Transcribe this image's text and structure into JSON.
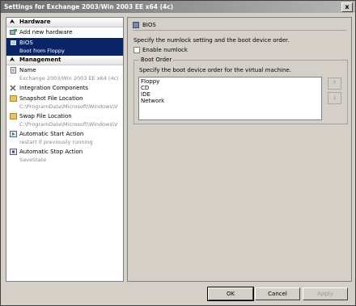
{
  "window": {
    "title": "Settings for Exchange 2003/Win 2003 EE x64 (4c)",
    "close_glyph": "x"
  },
  "sidebar": {
    "hardware_header": "Hardware",
    "management_header": "Management",
    "collapse_glyph": "⮝",
    "hardware_items": [
      {
        "label": "Add new hardware",
        "sub": ""
      },
      {
        "label": "BIOS",
        "sub": "Boot from Floppy"
      }
    ],
    "management_items": [
      {
        "label": "Name",
        "sub": "Exchange 2003/Win 2003 EE x64 (4c)"
      },
      {
        "label": "Integration Components",
        "sub": ""
      },
      {
        "label": "Snapshot File Location",
        "sub": "C:\\ProgramData\\Microsoft\\Windows\\V"
      },
      {
        "label": "Swap File Location",
        "sub": "C:\\ProgramData\\Microsoft\\Windows\\V"
      },
      {
        "label": "Automatic Start Action",
        "sub": "restart if previously running"
      },
      {
        "label": "Automatic Stop Action",
        "sub": "SaveState"
      }
    ]
  },
  "panel": {
    "header": "BIOS",
    "description": "Specify the numlock setting and the boot device order.",
    "numlock_label": "Enable numlock",
    "group_label": "Boot Order",
    "group_description": "Specify the boot device order for the virtual machine.",
    "boot_devices": [
      "Floppy",
      "CD",
      "IDE",
      "Network"
    ],
    "move_up_glyph": "↑",
    "move_down_glyph": "↓"
  },
  "buttons": {
    "ok": "OK",
    "cancel": "Cancel",
    "apply": "Apply"
  }
}
